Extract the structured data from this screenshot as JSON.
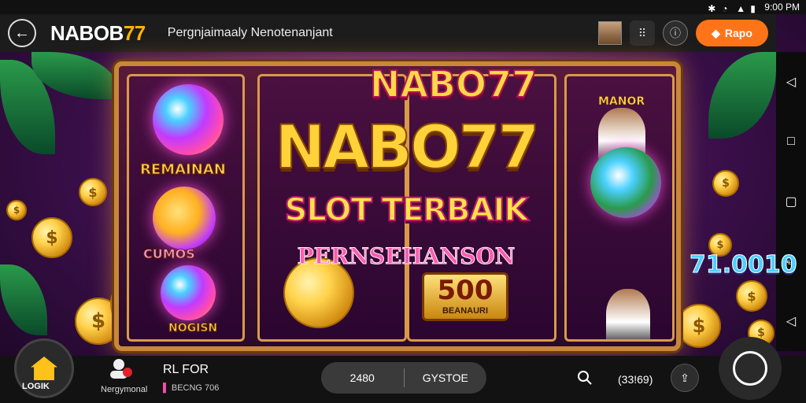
{
  "status_bar": {
    "time": "9:00 PM"
  },
  "app_bar": {
    "logo_main": "NABOB",
    "logo_accent": "77",
    "subtitle": "Pergnjaimaaly Nenotenanjant",
    "cta_label": "Rapo",
    "cta_icon": "diamond-icon",
    "cta_color": "#ff7418"
  },
  "game": {
    "brand_small": "NABO77",
    "brand_large": "NABO77",
    "slot_title": "SLOT TERBAIK",
    "prize_title": "PERNSEHANSON",
    "left_reel_label": "REMAINAN",
    "left_reel_sub": "CUMOS",
    "left_reel_bottom": "NOGISN",
    "center_badge_value": "500",
    "center_badge_caption": "BEANAURI",
    "right_reel_title": "MANOR",
    "jackpot_value": "71.0010"
  },
  "bottom_bar": {
    "home_label": "LOGIK",
    "user_label": "Nergymonal",
    "user_name": "RL FOR",
    "user_sub": "BECNG 706",
    "pill_left": "2480",
    "pill_right": "GYSTOE",
    "search_value": "(33!69)"
  },
  "nav_rail": [
    "back",
    "home",
    "recents",
    "tabs",
    "prev"
  ]
}
